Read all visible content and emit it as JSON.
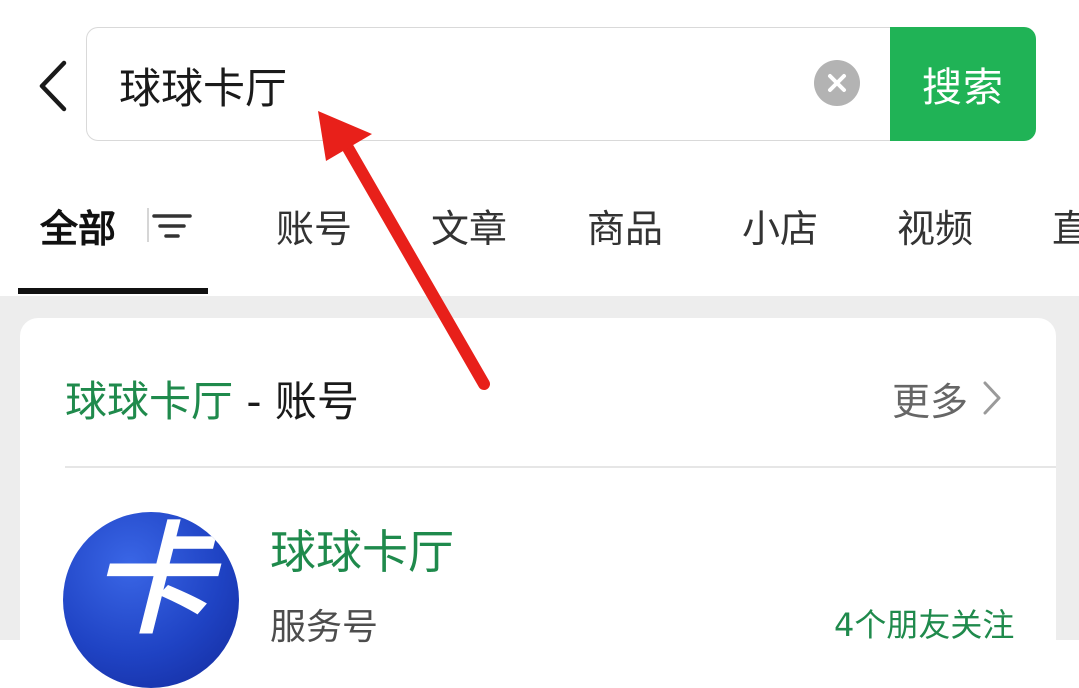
{
  "search": {
    "query": "球球卡厅",
    "button_label": "搜索"
  },
  "tabs": [
    {
      "label": "全部",
      "active": true
    },
    {
      "label": "账号",
      "active": false
    },
    {
      "label": "文章",
      "active": false
    },
    {
      "label": "商品",
      "active": false
    },
    {
      "label": "小店",
      "active": false
    },
    {
      "label": "视频",
      "active": false
    },
    {
      "label": "直",
      "active": false
    }
  ],
  "section": {
    "keyword": "球球卡厅",
    "suffix": " - 账号",
    "more_label": "更多"
  },
  "account": {
    "name": "球球卡厅",
    "type": "服务号",
    "followers": "4个朋友关注",
    "avatar_glyph": "卡"
  },
  "colors": {
    "accent_green": "#20b356",
    "keyword_green": "#1f8a4c",
    "annotation_red": "#e8201a",
    "avatar_blue": "#1f43c4"
  },
  "icons": {
    "back": "chevron-left-icon",
    "clear": "clear-x-icon",
    "filter": "filter-lines-icon",
    "more": "chevron-right-icon"
  }
}
